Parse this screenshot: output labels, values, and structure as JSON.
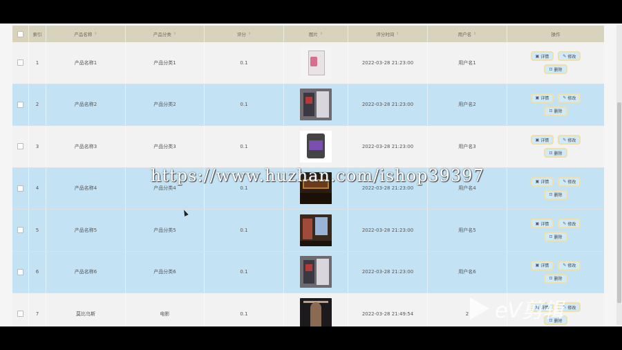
{
  "table": {
    "headers": {
      "index": "索引",
      "name": "产品名称",
      "category": "产品分类",
      "score": "评分",
      "image": "图片",
      "time": "评分时间",
      "user": "用户名",
      "ops": "操作"
    },
    "sort_glyph": "⇕",
    "rows": [
      {
        "index": "1",
        "name": "产品名称1",
        "category": "产品分类1",
        "score": "0.1",
        "time": "2022-03-28 21:23:00",
        "user": "用户名1",
        "image": "pc-case-pink"
      },
      {
        "index": "2",
        "name": "产品名称2",
        "category": "产品分类2",
        "score": "0.1",
        "time": "2022-03-28 21:23:00",
        "user": "用户名2",
        "image": "desktop-pc"
      },
      {
        "index": "3",
        "name": "产品名称3",
        "category": "产品分类3",
        "score": "0.1",
        "time": "2022-03-28 21:23:00",
        "user": "用户名3",
        "image": "hard-drive"
      },
      {
        "index": "4",
        "name": "产品名称4",
        "category": "产品分类4",
        "score": "0.1",
        "time": "2022-03-28 21:23:00",
        "user": "用户名4",
        "image": "gaming-room"
      },
      {
        "index": "5",
        "name": "产品名称5",
        "category": "产品分类5",
        "score": "0.1",
        "time": "2022-03-28 21:23:00",
        "user": "用户名5",
        "image": "gaming-hall"
      },
      {
        "index": "6",
        "name": "产品名称6",
        "category": "产品分类6",
        "score": "0.1",
        "time": "2022-03-28 21:23:00",
        "user": "用户名6",
        "image": "desktop-pc"
      },
      {
        "index": "7",
        "name": "莫比乌斯",
        "category": "电影",
        "score": "0.1",
        "time": "2022-03-28 21:49:54",
        "user": "2",
        "image": "movie-poster"
      }
    ],
    "buttons": {
      "detail": "详情",
      "edit": "修改",
      "delete": "删除"
    }
  },
  "watermark": "https://www.huzhan.com/ishop39397",
  "ev_logo": "eV剪辑",
  "colors": {
    "header": "#d8d3bc",
    "row_highlight": "#c3e3f5",
    "button_bg": "#cfeafa",
    "button_border": "#efe0a8"
  }
}
